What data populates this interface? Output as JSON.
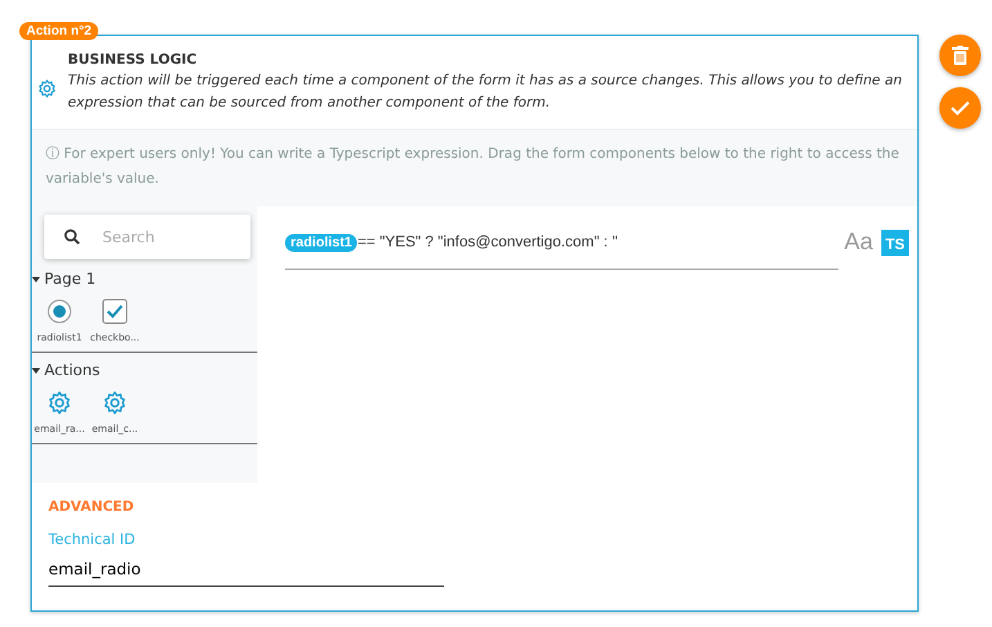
{
  "badge": "Action n°2",
  "header": {
    "title": "BUSINESS LOGIC",
    "description": "This action will be triggered each time a component of the form it has as a source changes. This allows you to define an expression that can be sourced from another component of the form."
  },
  "info": {
    "icon": "ⓘ",
    "text": "For expert users only! You can write a Typescript expression. Drag the form components below to the right to access the variable's value."
  },
  "search": {
    "placeholder": "Search"
  },
  "tree": [
    {
      "label": "Page 1",
      "expanded": true,
      "children": [
        {
          "kind": "radio",
          "label": "radiolist1"
        },
        {
          "kind": "checkbox",
          "label": "checkbo..."
        }
      ]
    },
    {
      "label": "Actions",
      "expanded": true,
      "children": [
        {
          "kind": "gear",
          "label": "email_ra..."
        },
        {
          "kind": "gear",
          "label": "email_c..."
        }
      ]
    }
  ],
  "expression": {
    "token": "radiolist1",
    "text": "== \"YES\" ? \"infos@convertigo.com\" : ''"
  },
  "modes": [
    {
      "label": "Aa",
      "selected": false
    },
    {
      "label": "TS",
      "selected": true
    }
  ],
  "advanced": {
    "title": "ADVANCED",
    "field_label": "Technical ID",
    "value": "email_radio"
  }
}
